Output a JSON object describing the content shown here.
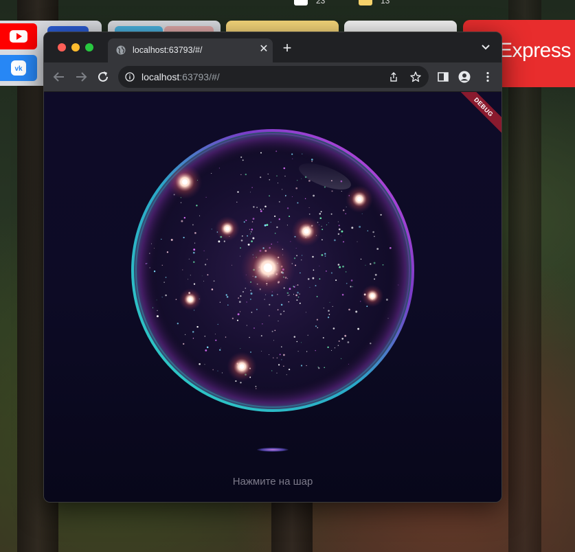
{
  "menubar": {
    "left_count": "23",
    "right_count": "13"
  },
  "dock": {
    "express_label": "Express"
  },
  "browser": {
    "tab_title": "localhost:63793/#/",
    "close_glyph": "✕",
    "new_tab_glyph": "+",
    "url_host": "localhost",
    "url_rest": ":63793/#/"
  },
  "app": {
    "debug_banner": "DEBUG",
    "hint": "Нажмите на шар"
  },
  "colors": {
    "page_bg": "#0e0b28",
    "sphere_rim_teal": "#2fd3c4",
    "sphere_rim_magenta": "#b43ad6",
    "express_red": "#e82d2d"
  }
}
